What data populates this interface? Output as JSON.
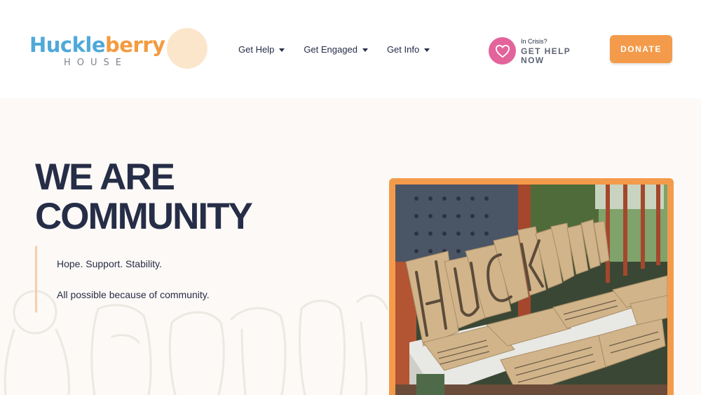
{
  "brand": {
    "word_part1": "Huckle",
    "word_part2": "berry",
    "sub": "HOUSE",
    "colors": {
      "blue": "#4fa9d8",
      "orange": "#f39b3f",
      "navy": "#262d47",
      "pink": "#e2649b",
      "donate": "#f39b4b"
    }
  },
  "nav": {
    "items": [
      {
        "label": "Get Help",
        "icon": "chevron-down-icon"
      },
      {
        "label": "Get Engaged",
        "icon": "chevron-down-icon"
      },
      {
        "label": "Get Info",
        "icon": "chevron-down-icon"
      }
    ]
  },
  "crisis": {
    "small": "In Crisis?",
    "big": "GET HELP NOW",
    "icon": "heart-icon"
  },
  "donate": {
    "label": "DONATE"
  },
  "hero": {
    "title_line1": "WE ARE",
    "title_line2": "COMMUNITY",
    "quote_line1": "Hope. Support. Stability.",
    "quote_line2": "All possible because of community."
  },
  "photo": {
    "sign_text": "HUCK HOUSE"
  }
}
